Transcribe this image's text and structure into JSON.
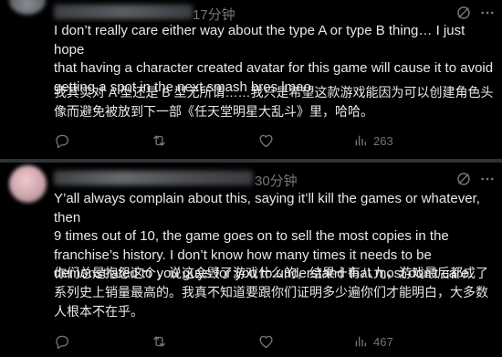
{
  "tweet1": {
    "timestamp": "17分钟",
    "text_en": "I don’t really care either way about the type A or type B thing… I just hope\nthat having a character created avatar for this game will cause it to avoid\ngetting a spot in the next smash bros lmao",
    "text_zh": "我其实对 A 型还是 B 型无所谓……我只是希望这款游戏能因为可以创建角色头\n像而避免被放到下一部《任天堂明星大乱斗》里，哈哈。",
    "views": "263"
  },
  "tweet2": {
    "timestamp": "30分钟",
    "text_en": "Y’all always complain about this, saying it’ll kill the games or whatever, then\n9 times out of 10, the game goes on to sell the most copies in the\nfranchise’s history. I don’t know how many times it needs to be\ndemonstrated to you guys for you to understand that most don’t care.",
    "text_zh": "你们总是抱怨这个，说这会毁了游戏什么的，结果十有八九，游戏最后都成了\n系列史上销量最高的。我真不知道要跟你们证明多少遍你们才能明白，大多数\n人根本不在乎。",
    "views": "467"
  },
  "icons": {
    "grok": "grok-icon",
    "more": "more-icon",
    "reply": "reply-icon",
    "retweet": "retweet-icon",
    "like": "like-icon",
    "views": "views-icon"
  },
  "colors": {
    "background": "#000000",
    "text": "#e7e9ea",
    "muted": "#71767b",
    "divider": "#2f3336"
  }
}
